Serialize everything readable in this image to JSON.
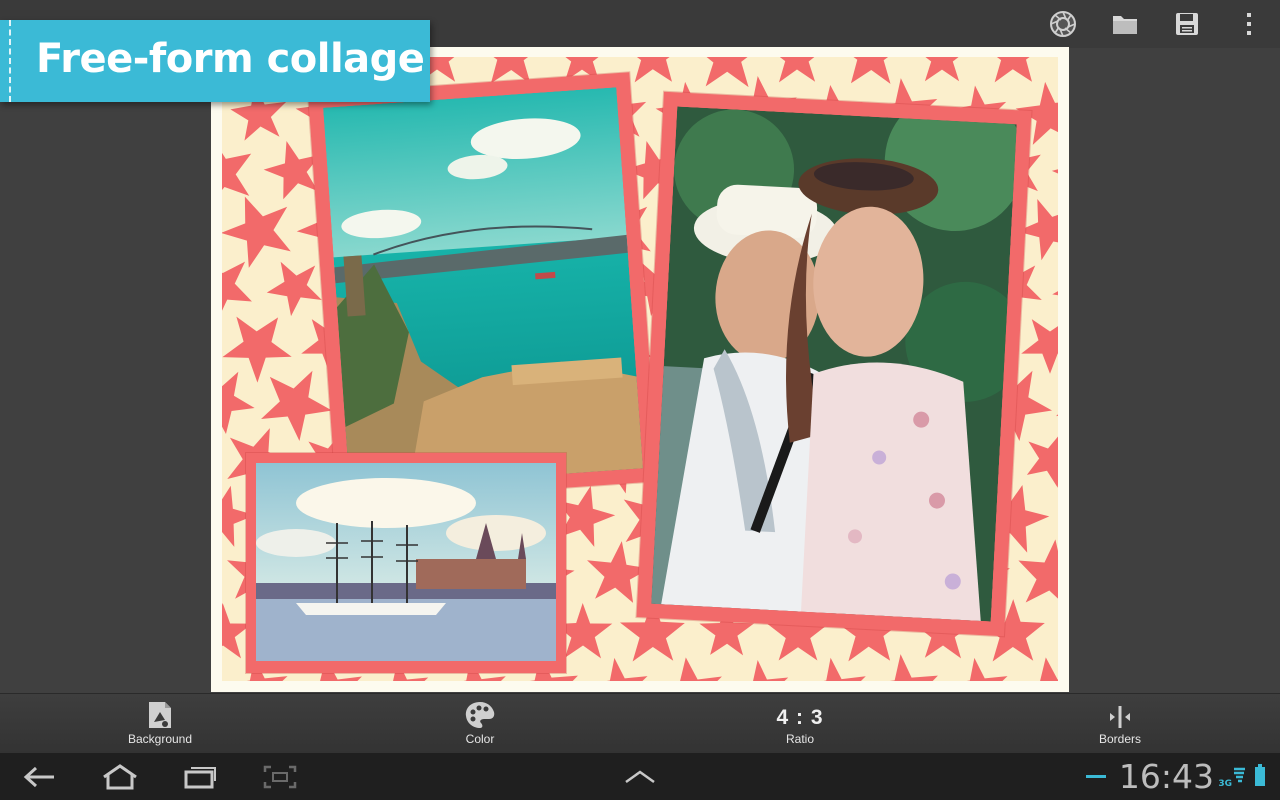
{
  "title_banner": {
    "text": "Free-form collage"
  },
  "top_actions": [
    {
      "name": "shutter-icon"
    },
    {
      "name": "folder-icon"
    },
    {
      "name": "save-icon"
    },
    {
      "name": "overflow-menu-icon"
    }
  ],
  "collage": {
    "background_pattern": "starfish",
    "background_color": "#fbefcc",
    "pattern_color": "#f26a6a",
    "frame_color": "#f26a6a",
    "photos": [
      {
        "name": "photo-fortress-bosphorus",
        "subject": "castle walls over a turquoise bay with a bridge"
      },
      {
        "name": "photo-couple",
        "subject": "smiling couple outdoors"
      },
      {
        "name": "photo-tall-ship",
        "subject": "sailing ship in harbor with city skyline"
      }
    ]
  },
  "toolbar": {
    "background_label": "Background",
    "color_label": "Color",
    "ratio_value": "4 : 3",
    "ratio_label": "Ratio",
    "borders_label": "Borders"
  },
  "system_bar": {
    "time": "16:43",
    "network": "3G",
    "accent": "#3bbad6"
  }
}
